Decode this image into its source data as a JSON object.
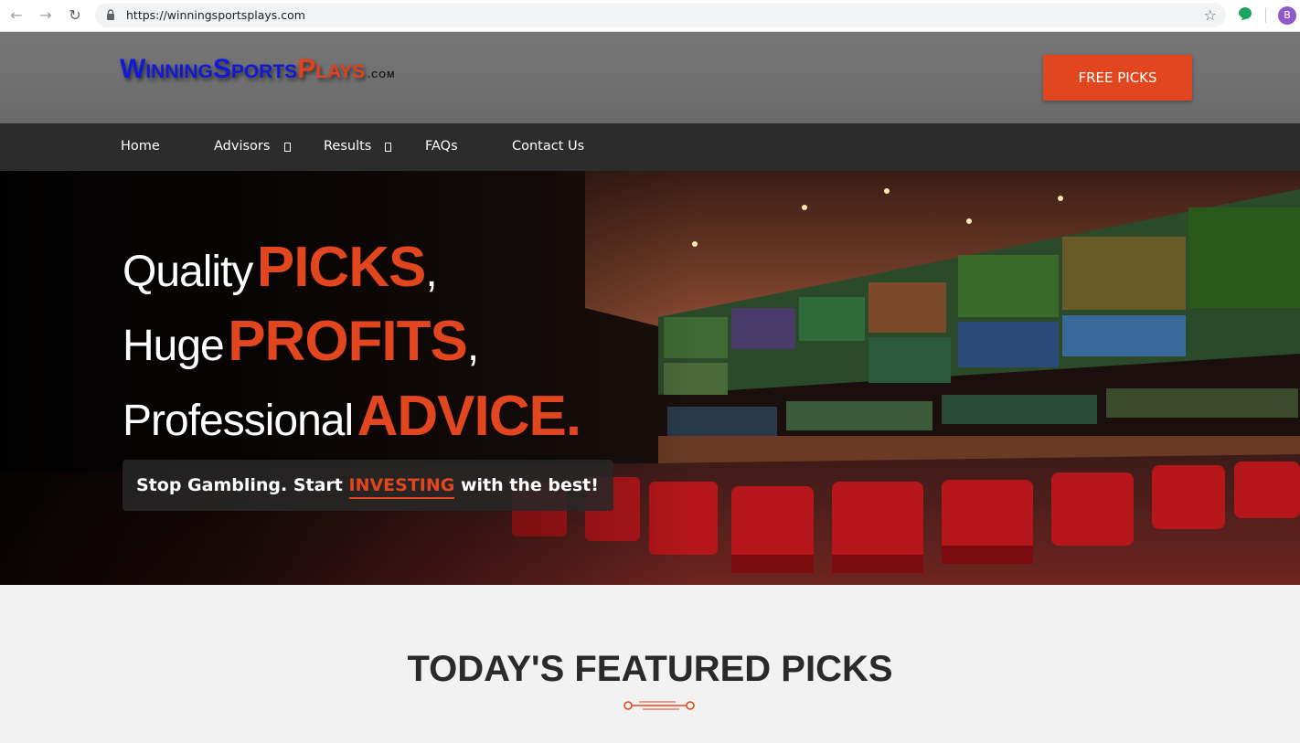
{
  "browser": {
    "url": "https://winningsportsplays.com",
    "profile_initial": "B",
    "icons": [
      "back-arrow-icon",
      "forward-arrow-icon",
      "reload-icon",
      "lock-icon",
      "bookmark-star-icon",
      "extension-icon"
    ]
  },
  "header": {
    "logo": {
      "w1_cap": "W",
      "w1_rest": "INNING",
      "w2_cap": "S",
      "w2_rest": "PORTS",
      "w3_cap": "P",
      "w3_rest": "LAYS",
      "suffix": ".COM"
    },
    "cta_label": "FREE PICKS"
  },
  "nav": {
    "items": [
      {
        "label": "Home",
        "has_dropdown": false
      },
      {
        "label": "Advisors",
        "has_dropdown": true
      },
      {
        "label": "Results",
        "has_dropdown": true
      },
      {
        "label": "FAQs",
        "has_dropdown": false
      },
      {
        "label": "Contact Us",
        "has_dropdown": false
      }
    ]
  },
  "hero": {
    "lines": [
      {
        "plain": "Quality",
        "accent": "PICKS",
        "end": ","
      },
      {
        "plain": "Huge",
        "accent": "PROFITS",
        "end": ","
      },
      {
        "plain": "Professional",
        "accent": "ADVICE.",
        "end": ""
      }
    ],
    "tagline": {
      "before": "Stop Gambling. Start ",
      "highlight": "INVESTING",
      "after": " with the best!"
    }
  },
  "featured": {
    "title": "TODAY'S FEATURED PICKS"
  },
  "colors": {
    "accent": "#e2461f",
    "logo_blue": "#1119d6",
    "nav_bg": "#2c2c2c",
    "header_bg": "#6f6f6f"
  }
}
